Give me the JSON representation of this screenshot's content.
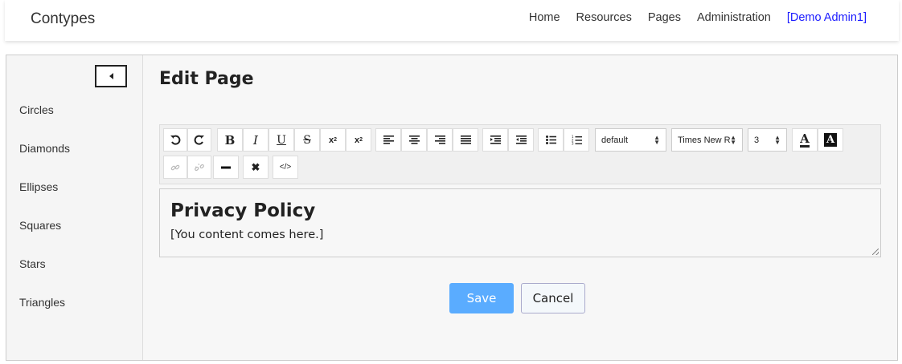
{
  "header": {
    "brand": "Contypes",
    "nav": [
      "Home",
      "Resources",
      "Pages",
      "Administration"
    ],
    "user": "[Demo Admin1]"
  },
  "sidebar": {
    "items": [
      "Circles",
      "Diamonds",
      "Ellipses",
      "Squares",
      "Stars",
      "Triangles"
    ]
  },
  "main": {
    "title": "Edit Page",
    "toolbar": {
      "format_select": "default",
      "font_select": "Times New R",
      "size_select": "3",
      "font_color_label": "A",
      "highlight_label": "A"
    },
    "editor": {
      "heading": "Privacy Policy",
      "body": "[You content comes here.]"
    },
    "save_label": "Save",
    "cancel_label": "Cancel"
  },
  "colors": {
    "accent": "#5aacff",
    "user_link": "#1a1aff"
  }
}
